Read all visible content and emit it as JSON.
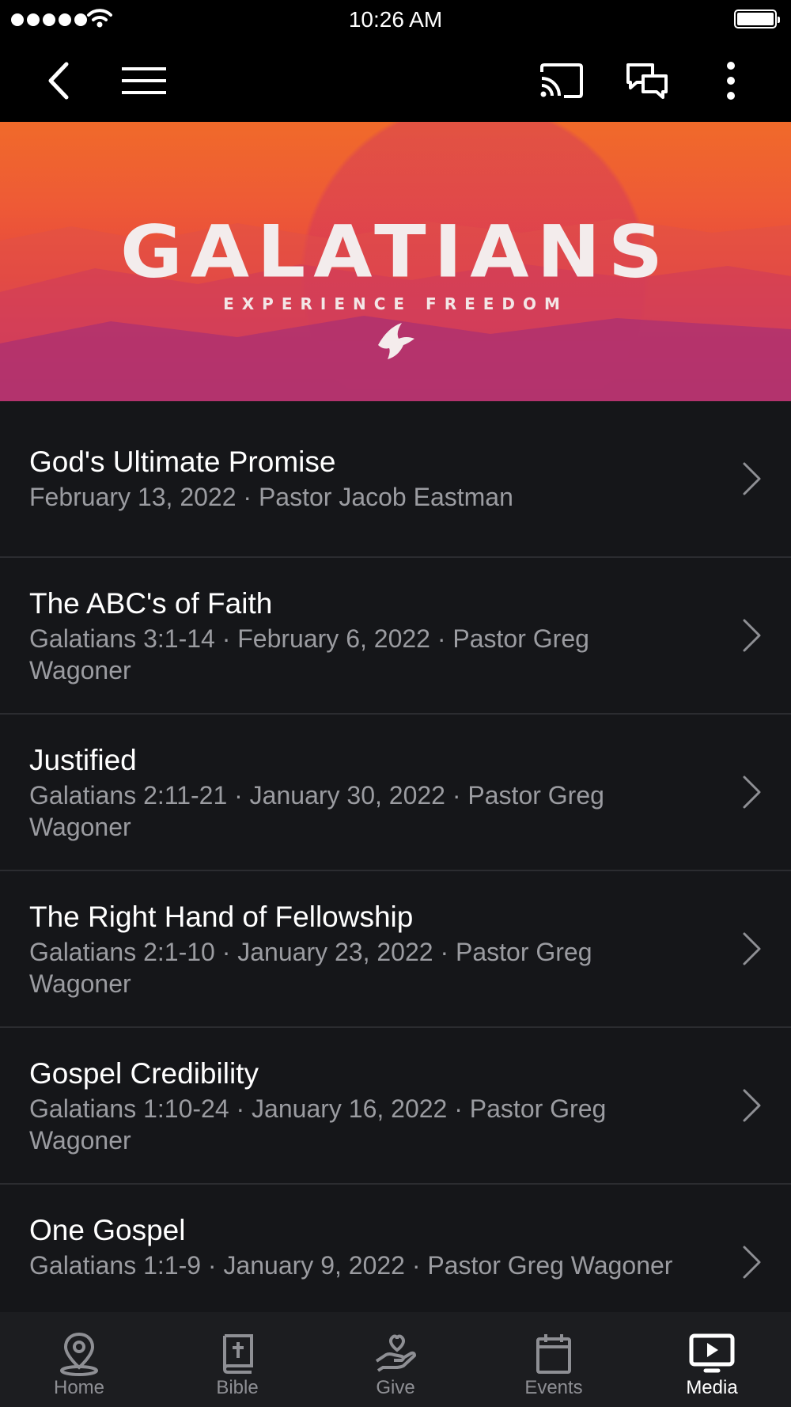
{
  "status_bar": {
    "time": "10:26 AM",
    "signal_bars": 5,
    "battery_level": 1.0
  },
  "nav_bar": {
    "back_icon": "chevron-left-icon",
    "menu_icon": "hamburger-menu-icon",
    "cast_icon": "cast-icon",
    "chat_icon": "chat-bubbles-icon",
    "more_icon": "more-vertical-icon"
  },
  "banner": {
    "title": "GALATIANS",
    "subtitle": "EXPERIENCE FREEDOM",
    "icon": "dove-icon",
    "colors": {
      "top": "#f06a2a",
      "bottom": "#b53272"
    }
  },
  "sermons": [
    {
      "title": "God's Ultimate Promise",
      "meta": "February 13, 2022 · Pastor Jacob Eastman"
    },
    {
      "title": "The ABC's of Faith",
      "meta": "Galatians 3:1-14 · February 6, 2022 · Pastor Greg Wagoner"
    },
    {
      "title": "Justified",
      "meta": "Galatians 2:11-21 · January 30, 2022 · Pastor Greg Wagoner"
    },
    {
      "title": "The Right Hand of Fellowship",
      "meta": "Galatians 2:1-10 · January 23, 2022 · Pastor Greg Wagoner"
    },
    {
      "title": "Gospel Credibility",
      "meta": "Galatians 1:10-24 · January 16, 2022 · Pastor Greg Wagoner"
    },
    {
      "title": "One Gospel",
      "meta": "Galatians 1:1-9 · January 9, 2022 · Pastor Greg Wagoner"
    }
  ],
  "tabs": [
    {
      "label": "Home",
      "icon": "map-pin-icon",
      "active": false
    },
    {
      "label": "Bible",
      "icon": "bible-icon",
      "active": false
    },
    {
      "label": "Give",
      "icon": "give-hand-heart-icon",
      "active": false
    },
    {
      "label": "Events",
      "icon": "calendar-icon",
      "active": false
    },
    {
      "label": "Media",
      "icon": "media-play-icon",
      "active": true
    }
  ],
  "colors": {
    "background": "#151619",
    "separator": "#2b2c30",
    "meta_text": "#9b9ca1",
    "tab_inactive": "#8e8f94",
    "tab_active": "#ffffff"
  }
}
